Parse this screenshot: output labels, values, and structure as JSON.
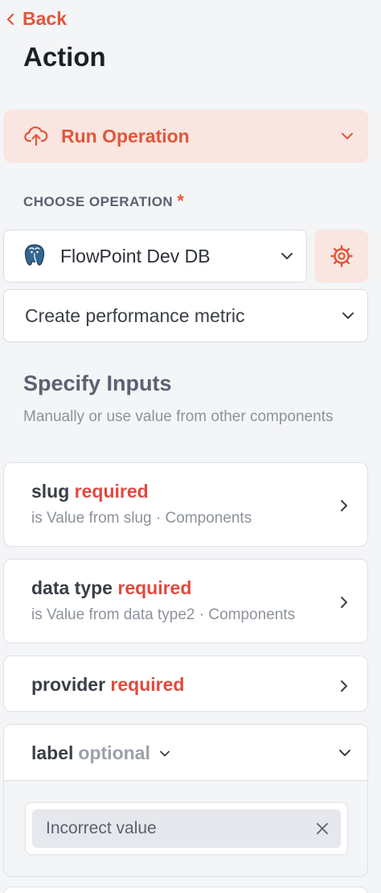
{
  "nav": {
    "back_label": "Back"
  },
  "page": {
    "title": "Action"
  },
  "run_panel": {
    "label": "Run Operation"
  },
  "choose_operation": {
    "label": "CHOOSE OPERATION",
    "required_mark": "*",
    "datasource": "FlowPoint Dev DB",
    "operation": "Create performance metric"
  },
  "inputs_section": {
    "title": "Specify Inputs",
    "subtitle": "Manually or use value from other components"
  },
  "inputs": [
    {
      "name": "slug",
      "tag": "required",
      "desc": "is Value from slug · Components"
    },
    {
      "name": "data type",
      "tag": "required",
      "desc": "is Value from data type2 · Components"
    },
    {
      "name": "provider",
      "tag": "required"
    }
  ],
  "label_input": {
    "name": "label",
    "tag": "optional",
    "value": "Incorrect value"
  },
  "colors": {
    "accent": "#e0573a",
    "accent_bg": "#f9e6e1",
    "required": "#e04a3f",
    "background": "#f4f5f7"
  },
  "icons": {
    "back": "chevron-left-icon",
    "run": "cloud-upload-icon",
    "datasource": "postgresql-icon",
    "settings": "gear-icon",
    "expand": "chevron-down-icon",
    "open": "chevron-right-icon",
    "clear": "close-icon"
  }
}
